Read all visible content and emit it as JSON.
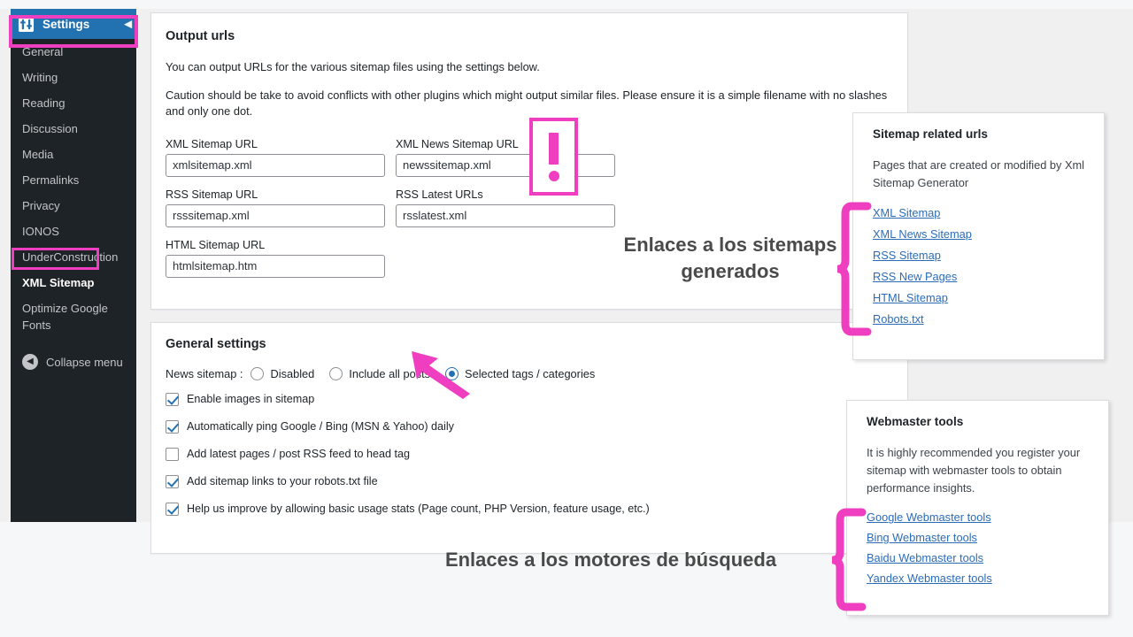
{
  "colors": {
    "accent_pink": "#ef3fc0",
    "wp_blue": "#2271b1",
    "sidebar_bg": "#1d2327",
    "link_blue": "#2b6cb8"
  },
  "sidebar": {
    "header": {
      "label": "Settings",
      "icon": "settings-sliders-icon",
      "collapse_chevron": "◀"
    },
    "items": [
      {
        "label": "General",
        "current": false
      },
      {
        "label": "Writing",
        "current": false
      },
      {
        "label": "Reading",
        "current": false
      },
      {
        "label": "Discussion",
        "current": false
      },
      {
        "label": "Media",
        "current": false
      },
      {
        "label": "Permalinks",
        "current": false
      },
      {
        "label": "Privacy",
        "current": false
      },
      {
        "label": "IONOS",
        "current": false
      },
      {
        "label": "UnderConstruction",
        "current": false
      },
      {
        "label": "XML Sitemap",
        "current": true
      },
      {
        "label": "Optimize Google Fonts",
        "current": false
      }
    ],
    "collapse": {
      "label": "Collapse menu",
      "icon": "collapse-arrow-icon",
      "glyph": "◀"
    }
  },
  "output_urls": {
    "title": "Output urls",
    "desc1": "You can output URLs for the various sitemap files using the settings below.",
    "desc2": "Caution should be take to avoid conflicts with other plugins which might output similar files. Please ensure it is a simple filename with no slashes and only one dot.",
    "fields": [
      {
        "label": "XML Sitemap URL",
        "value": "xmlsitemap.xml"
      },
      {
        "label": "XML News Sitemap URL",
        "value": "newssitemap.xml"
      },
      {
        "label": "RSS Sitemap URL",
        "value": "rsssitemap.xml"
      },
      {
        "label": "RSS Latest URLs",
        "value": "rsslatest.xml"
      },
      {
        "label": "HTML Sitemap URL",
        "value": "htmlsitemap.htm"
      }
    ]
  },
  "general_settings": {
    "title": "General settings",
    "news_sitemap_label": "News sitemap :",
    "radios": [
      {
        "label": "Disabled",
        "selected": false
      },
      {
        "label": "Include all posts",
        "selected": false
      },
      {
        "label": "Selected tags / categories",
        "selected": true
      }
    ],
    "checkboxes": [
      {
        "label": "Enable images in sitemap",
        "checked": true
      },
      {
        "label": "Automatically ping Google / Bing (MSN & Yahoo) daily",
        "checked": true
      },
      {
        "label": "Add latest pages / post RSS feed to head tag",
        "checked": false
      },
      {
        "label": "Add sitemap links to your robots.txt file",
        "checked": true
      },
      {
        "label": "Help us improve by allowing basic usage stats (Page count, PHP Version, feature usage, etc.)",
        "checked": true
      }
    ]
  },
  "sitemap_panel": {
    "title": "Sitemap related urls",
    "desc": "Pages that are created or modified by Xml Sitemap Generator",
    "links": [
      "XML Sitemap",
      "XML News Sitemap",
      "RSS Sitemap",
      "RSS New Pages",
      "HTML Sitemap",
      "Robots.txt"
    ]
  },
  "webmaster_panel": {
    "title": "Webmaster tools",
    "desc": "It is highly recommended you register your sitemap with webmaster tools to obtain performance insights.",
    "links": [
      "Google Webmaster tools",
      "Bing Webmaster tools",
      "Baidu Webmaster tools",
      "Yandex Webmaster tools"
    ]
  },
  "annotations": {
    "sitemaps_caption": "Enlaces a los sitemaps generados",
    "engines_caption": "Enlaces a los motores de búsqueda",
    "exclamation": "!"
  }
}
